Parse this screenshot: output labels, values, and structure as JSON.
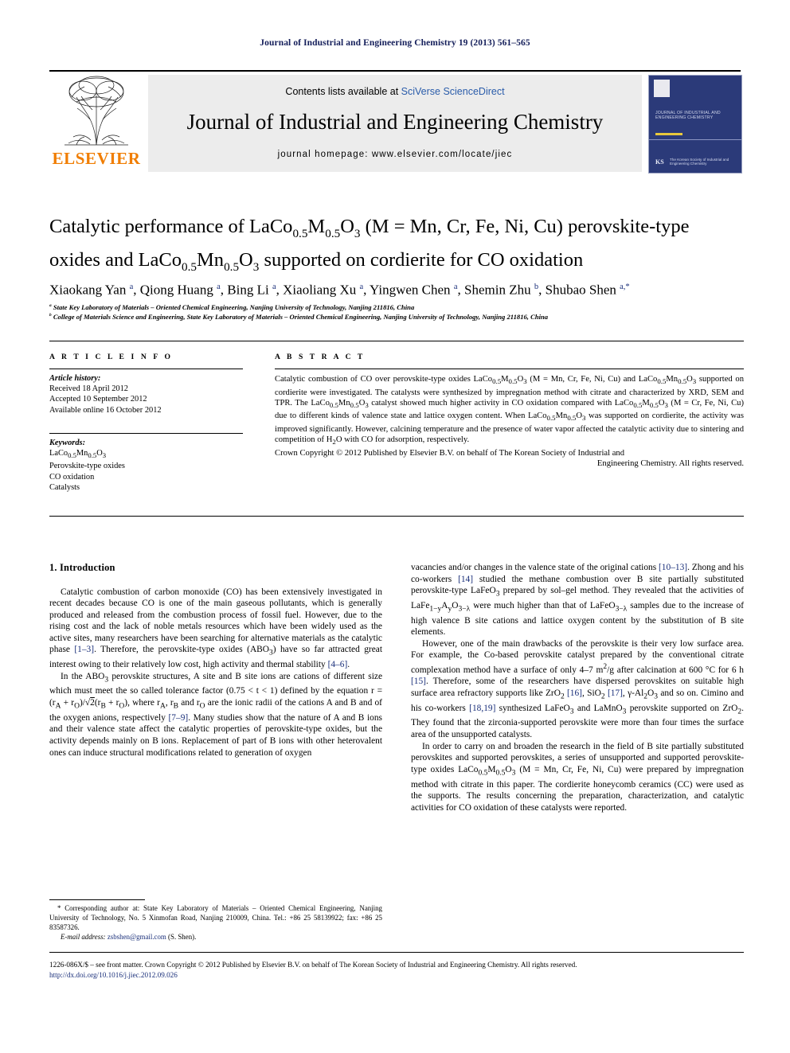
{
  "running_head": "Journal of Industrial and Engineering Chemistry 19 (2013) 561–565",
  "masthead": {
    "publisher_name": "ELSEVIER",
    "contents_prefix": "Contents lists available at ",
    "contents_link": "SciVerse ScienceDirect",
    "journal_name": "Journal of Industrial and Engineering Chemistry",
    "homepage": "journal homepage: www.elsevier.com/locate/jiec",
    "cover": {
      "title": "JOURNAL OF INDUSTRIAL AND ENGINEERING CHEMISTRY",
      "society": "The Korean Society of Industrial and Engineering Chemistry"
    }
  },
  "article": {
    "title_line1_a": "Catalytic performance of LaCo",
    "title_line1_b": "M",
    "title_line1_c": "O",
    "title_line1_d": " (M = Mn, Cr, Fe, Ni, Cu) perovskite-type",
    "title_line2_a": "oxides and LaCo",
    "title_line2_b": "Mn",
    "title_line2_c": "O",
    "title_line2_d": " supported on cordierite for CO oxidation",
    "authors": "Xiaokang Yan a, Qiong Huang a, Bing Li a, Xiaoliang Xu a, Yingwen Chen a, Shemin Zhu b, Shubao Shen a,*",
    "affiliation_a": "a State Key Laboratory of Materials – Oriented Chemical Engineering, Nanjing University of Technology, Nanjing 211816, China",
    "affiliation_b": "b College of Materials Science and Engineering, State Key Laboratory of Materials – Oriented Chemical Engineering, Nanjing University of Technology, Nanjing 211816, China"
  },
  "article_info": {
    "heading": "A R T I C L E   I N F O",
    "history_label": "Article history:",
    "history": [
      "Received 18 April 2012",
      "Accepted 10 September 2012",
      "Available online 16 October 2012"
    ],
    "keywords_label": "Keywords:",
    "keywords": [
      "LaCo0.5Mn0.5O3",
      "Perovskite-type oxides",
      "CO oxidation",
      "Catalysts"
    ]
  },
  "abstract": {
    "heading": "A B S T R A C T",
    "copyright_line1": "Crown Copyright © 2012 Published by Elsevier B.V. on behalf of The Korean Society of Industrial and",
    "copyright_line2": "Engineering Chemistry. All rights reserved."
  },
  "body": {
    "section_heading": "1. Introduction"
  },
  "footnote": {
    "corresponding": "* Corresponding author at: State Key Laboratory of Materials – Oriented Chemical Engineering, Nanjing University of Technology, No. 5 Xinmofan Road, Nanjing 210009, China. Tel.: +86 25 58139922; fax: +86 25 83587326.",
    "email_label": "E-mail address:",
    "email": "zsbshen@gmail.com",
    "email_suffix": "(S. Shen)."
  },
  "footer": {
    "issn_line": "1226-086X/$ – see front matter. Crown Copyright © 2012 Published by Elsevier B.V. on behalf of The Korean Society of Industrial and Engineering Chemistry. All rights reserved.",
    "doi": "http://dx.doi.org/10.1016/j.jiec.2012.09.026"
  },
  "colors": {
    "link_blue": "#1a2f7a",
    "elsevier_orange": "#F07D00",
    "cover_blue": "#2b3a79",
    "panel_grey": "#ececec"
  }
}
